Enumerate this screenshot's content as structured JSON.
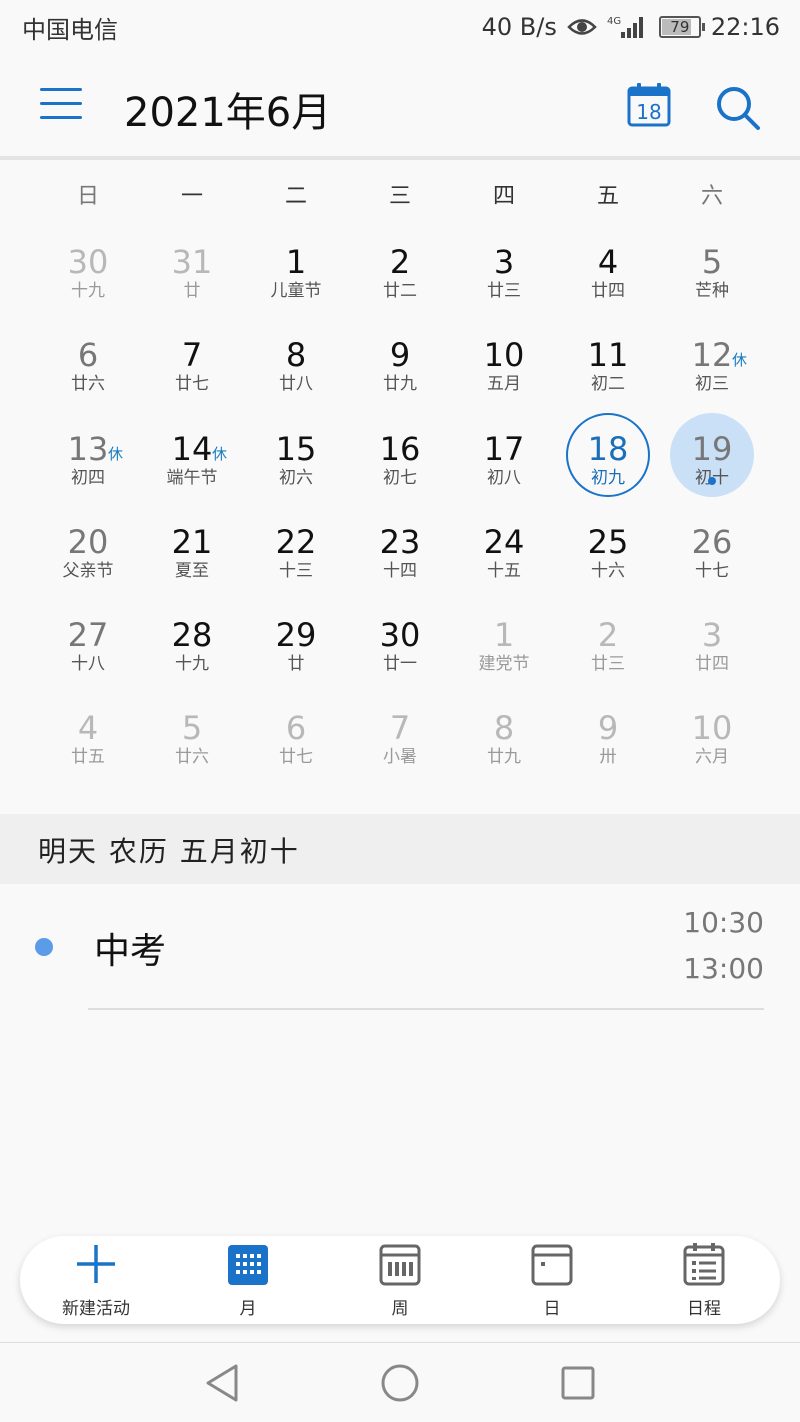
{
  "status_bar": {
    "carrier": "中国电信",
    "speed": "40 B/s",
    "network": "4G",
    "battery": "79",
    "time": "22:16"
  },
  "header": {
    "title": "2021年6月",
    "today_icon_day": "18",
    "icons": [
      "menu-icon",
      "today-icon",
      "search-icon"
    ]
  },
  "weekdays": [
    "日",
    "一",
    "二",
    "三",
    "四",
    "五",
    "六"
  ],
  "calendar": {
    "weeks": [
      [
        {
          "day": "30",
          "lunar": "十九",
          "other": true
        },
        {
          "day": "31",
          "lunar": "廿",
          "other": true
        },
        {
          "day": "1",
          "lunar": "儿童节"
        },
        {
          "day": "2",
          "lunar": "廿二"
        },
        {
          "day": "3",
          "lunar": "廿三"
        },
        {
          "day": "4",
          "lunar": "廿四"
        },
        {
          "day": "5",
          "lunar": "芒种"
        }
      ],
      [
        {
          "day": "6",
          "lunar": "廿六"
        },
        {
          "day": "7",
          "lunar": "廿七"
        },
        {
          "day": "8",
          "lunar": "廿八"
        },
        {
          "day": "9",
          "lunar": "廿九"
        },
        {
          "day": "10",
          "lunar": "五月"
        },
        {
          "day": "11",
          "lunar": "初二"
        },
        {
          "day": "12",
          "lunar": "初三",
          "rest": "休"
        }
      ],
      [
        {
          "day": "13",
          "lunar": "初四",
          "rest": "休"
        },
        {
          "day": "14",
          "lunar": "端午节",
          "rest": "休"
        },
        {
          "day": "15",
          "lunar": "初六"
        },
        {
          "day": "16",
          "lunar": "初七"
        },
        {
          "day": "17",
          "lunar": "初八"
        },
        {
          "day": "18",
          "lunar": "初九",
          "today": true
        },
        {
          "day": "19",
          "lunar": "初十",
          "selected": true,
          "has_event": true
        }
      ],
      [
        {
          "day": "20",
          "lunar": "父亲节"
        },
        {
          "day": "21",
          "lunar": "夏至"
        },
        {
          "day": "22",
          "lunar": "十三"
        },
        {
          "day": "23",
          "lunar": "十四"
        },
        {
          "day": "24",
          "lunar": "十五"
        },
        {
          "day": "25",
          "lunar": "十六"
        },
        {
          "day": "26",
          "lunar": "十七"
        }
      ],
      [
        {
          "day": "27",
          "lunar": "十八"
        },
        {
          "day": "28",
          "lunar": "十九"
        },
        {
          "day": "29",
          "lunar": "廿"
        },
        {
          "day": "30",
          "lunar": "廿一"
        },
        {
          "day": "1",
          "lunar": "建党节",
          "other": true
        },
        {
          "day": "2",
          "lunar": "廿三",
          "other": true
        },
        {
          "day": "3",
          "lunar": "廿四",
          "other": true
        }
      ],
      [
        {
          "day": "4",
          "lunar": "廿五",
          "other": true
        },
        {
          "day": "5",
          "lunar": "廿六",
          "other": true
        },
        {
          "day": "6",
          "lunar": "廿七",
          "other": true
        },
        {
          "day": "7",
          "lunar": "小暑",
          "other": true
        },
        {
          "day": "8",
          "lunar": "廿九",
          "other": true
        },
        {
          "day": "9",
          "lunar": "卅",
          "other": true
        },
        {
          "day": "10",
          "lunar": "六月",
          "other": true
        }
      ]
    ]
  },
  "agenda": {
    "header": "明天  农历 五月初十",
    "events": [
      {
        "title": "中考",
        "start": "10:30",
        "end": "13:00",
        "color": "#5b9be8"
      }
    ]
  },
  "bottom_nav": {
    "items": [
      {
        "label": "新建活动",
        "icon": "plus-icon"
      },
      {
        "label": "月",
        "icon": "month-grid-icon",
        "active": true
      },
      {
        "label": "周",
        "icon": "week-icon"
      },
      {
        "label": "日",
        "icon": "day-icon"
      },
      {
        "label": "日程",
        "icon": "agenda-icon"
      }
    ]
  },
  "colors": {
    "accent": "#1a73c9",
    "selected_fill": "#c9e0f7",
    "event_dot": "#5b9be8",
    "rest_label": "#1a7cc2"
  }
}
